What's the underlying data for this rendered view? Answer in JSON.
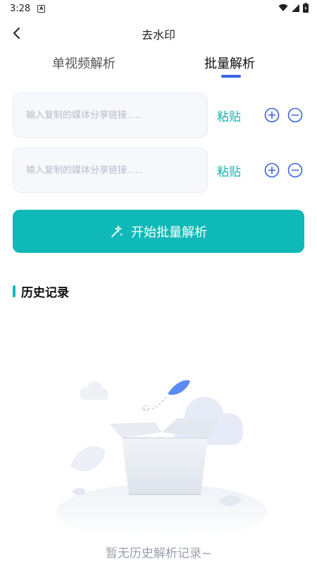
{
  "status_bar": {
    "time": "3:28",
    "notification_letter": "A"
  },
  "app_bar": {
    "title": "去水印"
  },
  "tabs": [
    {
      "label": "单视频解析",
      "active": false
    },
    {
      "label": "批量解析",
      "active": true
    }
  ],
  "link_rows": [
    {
      "placeholder": "输入复制的媒体分享链接.....",
      "value": "",
      "paste_label": "粘贴"
    },
    {
      "placeholder": "输入复制的媒体分享链接.....",
      "value": "",
      "paste_label": "粘贴"
    }
  ],
  "start_button": {
    "label": "开始批量解析"
  },
  "history": {
    "title": "历史记录",
    "empty_text": "暂无历史解析记录~"
  },
  "colors": {
    "accent": "#0fb9b7",
    "tab_indicator": "#3a63e0",
    "icon_blue": "#3a63e0"
  }
}
